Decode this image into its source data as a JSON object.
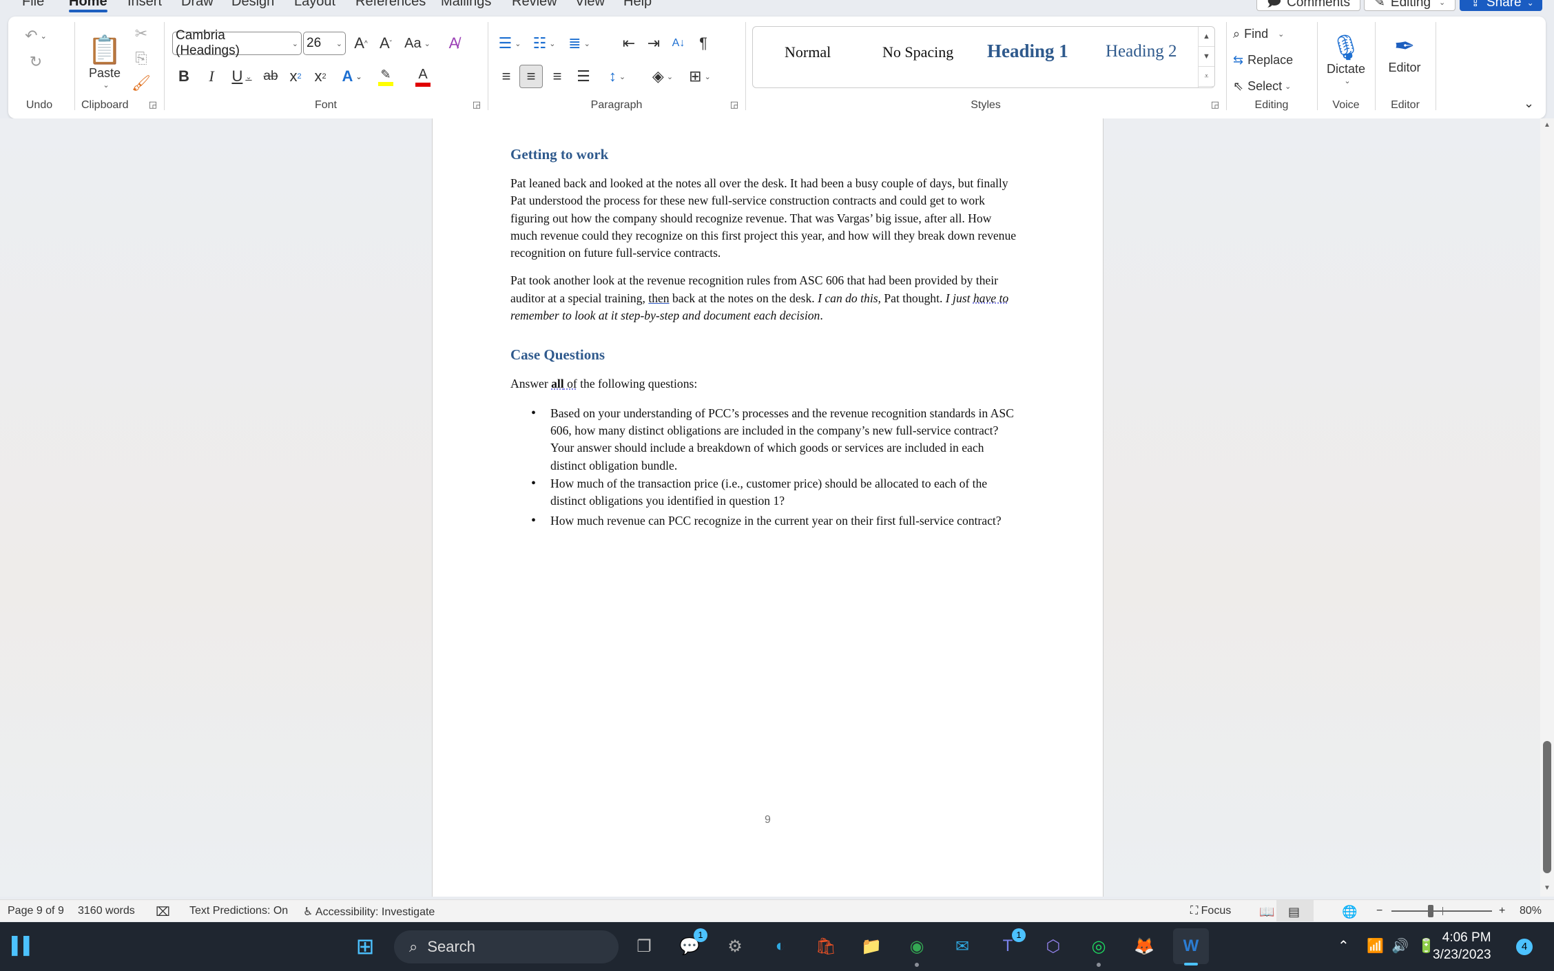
{
  "menu": {
    "tabs": [
      "File",
      "Home",
      "Insert",
      "Draw",
      "Design",
      "Layout",
      "References",
      "Mailings",
      "Review",
      "View",
      "Help"
    ],
    "active_tab": "Home",
    "comments_label": "Comments",
    "editing_label": "Editing",
    "share_label": "Share"
  },
  "ribbon": {
    "undo_group": "Undo",
    "clipboard_group": "Clipboard",
    "paste_label": "Paste",
    "font_group": "Font",
    "font_name": "Cambria (Headings)",
    "font_size": "26",
    "paragraph_group": "Paragraph",
    "styles_group": "Styles",
    "styles": [
      "Normal",
      "No Spacing",
      "Heading 1",
      "Heading 2"
    ],
    "editing_group": "Editing",
    "find_label": "Find",
    "replace_label": "Replace",
    "select_label": "Select",
    "voice_group": "Voice",
    "dictate_label": "Dictate",
    "editor_group": "Editor",
    "editor_label": "Editor",
    "colors": {
      "highlight": "#ffff00",
      "font_color": "#e00000",
      "accent": "#1a5cc2",
      "heading": "#2f5a8d"
    }
  },
  "document": {
    "section1": {
      "heading": "Getting to work",
      "p1": "Pat leaned back and looked at the notes all over the desk. It had been a busy couple of days, but finally Pat understood the process for these new full-service construction contracts and could get to work figuring out how the company should recognize revenue. That was Vargas’ big issue, after all. How much revenue could they recognize on this first project this year, and how will they break down revenue recognition on future full-service contracts.",
      "p2_a": "Pat took another look at the revenue recognition rules from ASC 606 that had been provided by their auditor at a special training, ",
      "p2_then": "then",
      "p2_b": " back at the notes on the desk. ",
      "p2_italic1": "I can do this,",
      "p2_c": " Pat thought. ",
      "p2_italic2a": "I just ",
      "p2_italic2_haveto": "have to",
      "p2_italic2b": " remember to look at it step-by-step and document each decision",
      "p2_end": "."
    },
    "section2": {
      "heading": "Case Questions",
      "intro_a": "Answer ",
      "intro_bold": "all",
      "intro_of": " of",
      "intro_b": " the following questions:",
      "questions": [
        "Based on your understanding of PCC’s processes and the revenue recognition standards in ASC 606, how many distinct obligations are included in the company’s new full-service contract? Your answer should include a breakdown of which goods or services are included in each distinct obligation bundle.",
        "How much of the transaction price (i.e., customer price) should be allocated to each of the distinct obligations you identified in question 1?",
        "How much revenue can PCC recognize in the current year on their first full-service contract?"
      ]
    },
    "page_number": "9"
  },
  "status": {
    "page": "Page 9 of 9",
    "words": "3160 words",
    "text_predictions": "Text Predictions: On",
    "accessibility": "Accessibility: Investigate",
    "focus": "Focus",
    "zoom_level": "80%",
    "zoom_percent": 80
  },
  "taskbar": {
    "search_placeholder": "Search",
    "meet_badge": "1",
    "teams_badge": "1",
    "time": "4:06 PM",
    "date": "3/23/2023",
    "notifications": "4"
  }
}
